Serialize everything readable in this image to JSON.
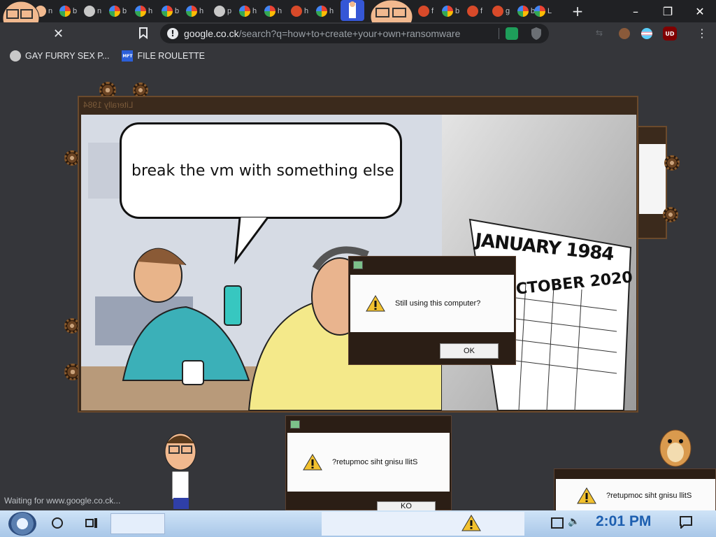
{
  "browser": {
    "tabs": [
      {
        "letter": "n",
        "icon": "face"
      },
      {
        "letter": "b",
        "icon": "google"
      },
      {
        "letter": "n",
        "icon": "globe"
      },
      {
        "letter": "b",
        "icon": "google"
      },
      {
        "letter": "h",
        "icon": "google"
      },
      {
        "letter": "b",
        "icon": "google"
      },
      {
        "letter": "h",
        "icon": "google"
      },
      {
        "letter": "p",
        "icon": "globe"
      },
      {
        "letter": "h",
        "icon": "google"
      },
      {
        "letter": "h",
        "icon": "google"
      },
      {
        "letter": "h",
        "icon": "red"
      },
      {
        "letter": "h",
        "icon": "google"
      },
      {
        "letter": "f",
        "icon": "red"
      },
      {
        "letter": "b",
        "icon": "google"
      },
      {
        "letter": "f",
        "icon": "red"
      },
      {
        "letter": "g",
        "icon": "red"
      },
      {
        "letter": "b",
        "icon": "google"
      },
      {
        "letter": "L",
        "icon": "google"
      }
    ],
    "url_domain": "google.co.ck",
    "url_path": "/search?q=how+to+create+your+own+ransomware",
    "bookmarks": [
      "GAY FURRY SEX P...",
      "FILE ROULETTE"
    ],
    "status_text": "Waiting for www.google.co.ck...",
    "ext_badge": "UD"
  },
  "main_window": {
    "title": "Literally 1984",
    "speech": "break the vm with something else",
    "calendar_top": "JANUARY 1984",
    "calendar_bottom": "OCTOBER 2020"
  },
  "dialog_main": {
    "message": "Still using this computer?",
    "ok": "OK"
  },
  "dialog_reversed": {
    "message": "?retupmoc siht gnisu llitS",
    "ok": "KO"
  },
  "dialog_corner": {
    "message": "?retupmoc siht gnisu llitS"
  },
  "taskbar": {
    "clock": "2:01 PM"
  },
  "colors": {
    "accent": "#1a73e8",
    "steam": "#3b2a1c",
    "taskbar": "#a9c7e8"
  }
}
